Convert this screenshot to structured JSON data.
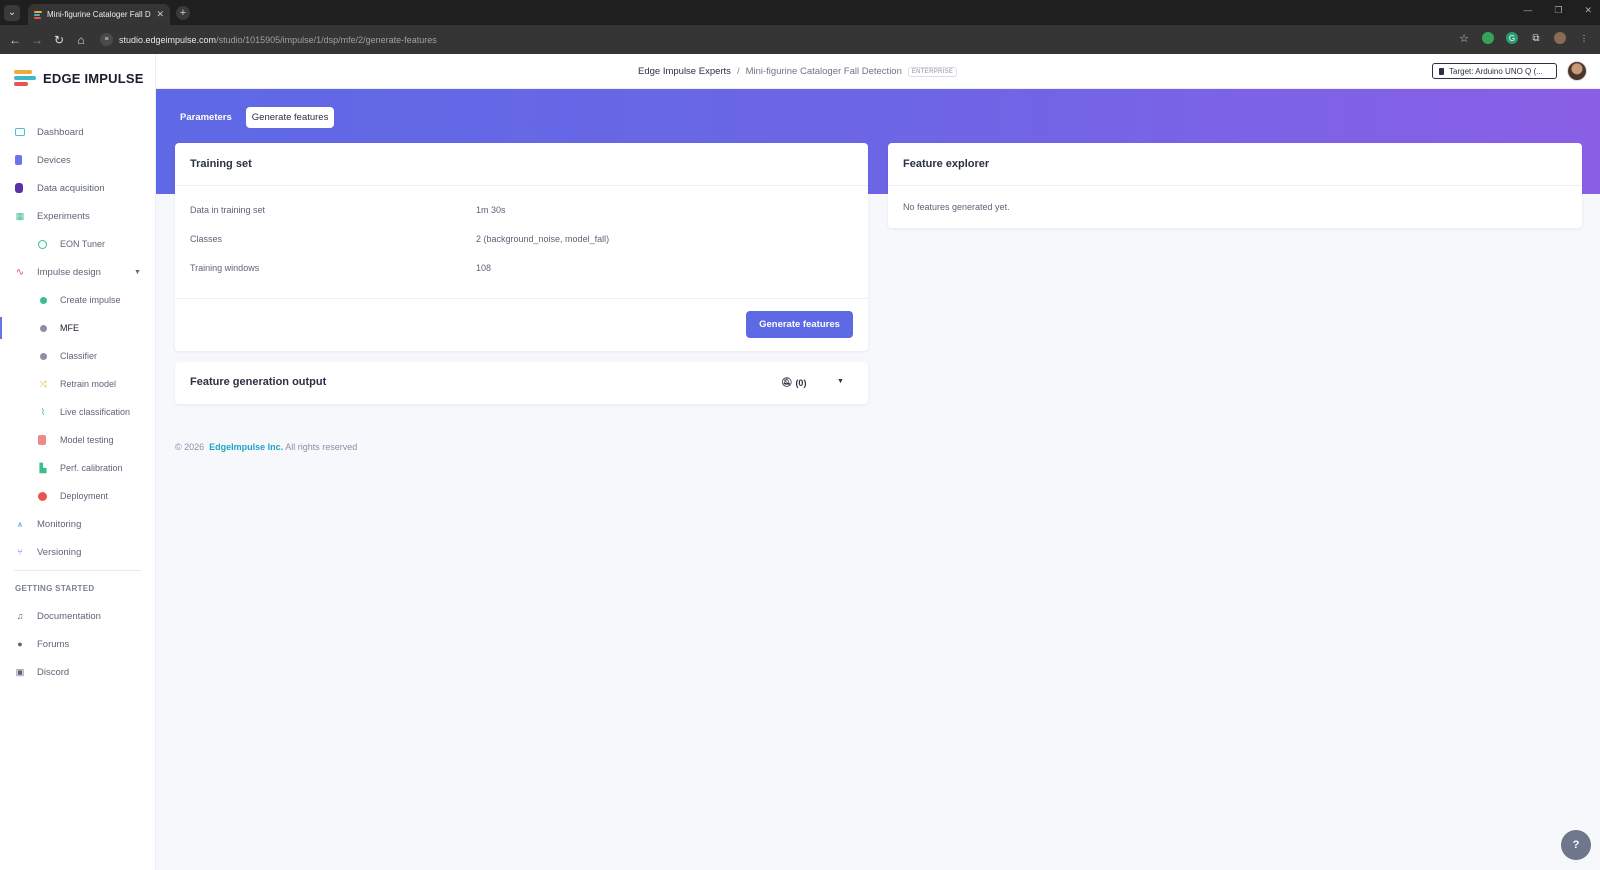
{
  "browser": {
    "tab_title": "Mini-figurine Cataloger Fall Det",
    "url_host": "studio.edgeimpulse.com",
    "url_path": "/studio/1015905/impulse/1/dsp/mfe/2/generate-features"
  },
  "brand": {
    "name": "EDGE IMPULSE"
  },
  "header": {
    "org": "Edge Impulse Experts",
    "separator": "/",
    "project": "Mini-figurine Cataloger Fall Detection",
    "plan_badge": "ENTERPRISE",
    "target_label": "Target: Arduino UNO Q (..."
  },
  "sidebar": {
    "items": [
      {
        "label": "Dashboard",
        "icon": "monitor-icon"
      },
      {
        "label": "Devices",
        "icon": "device-icon"
      },
      {
        "label": "Data acquisition",
        "icon": "database-icon"
      },
      {
        "label": "Experiments",
        "icon": "table-icon"
      },
      {
        "label": "EON Tuner",
        "icon": "tuner-icon"
      },
      {
        "label": "Impulse design",
        "icon": "pulse-icon"
      },
      {
        "label": "Create impulse",
        "icon": "dot-icon"
      },
      {
        "label": "MFE",
        "icon": "dot-icon"
      },
      {
        "label": "Classifier",
        "icon": "dot-icon"
      },
      {
        "label": "Retrain model",
        "icon": "shuffle-icon"
      },
      {
        "label": "Live classification",
        "icon": "live-icon"
      },
      {
        "label": "Model testing",
        "icon": "clipboard-icon"
      },
      {
        "label": "Perf. calibration",
        "icon": "bar-chart-icon"
      },
      {
        "label": "Deployment",
        "icon": "box-icon"
      },
      {
        "label": "Monitoring",
        "icon": "monitoring-icon"
      },
      {
        "label": "Versioning",
        "icon": "branch-icon"
      }
    ],
    "section_title": "GETTING STARTED",
    "getting_started": [
      {
        "label": "Documentation",
        "icon": "docs-icon"
      },
      {
        "label": "Forums",
        "icon": "forum-icon"
      },
      {
        "label": "Discord",
        "icon": "discord-icon"
      }
    ]
  },
  "tabs": {
    "parameters": "Parameters",
    "generate": "Generate features"
  },
  "training_set": {
    "title": "Training set",
    "rows": [
      {
        "label": "Data in training set",
        "value": "1m 30s"
      },
      {
        "label": "Classes",
        "value": "2 (background_noise, model_fall)"
      },
      {
        "label": "Training windows",
        "value": "108"
      }
    ],
    "button": "Generate features"
  },
  "feature_output": {
    "title": "Feature generation output",
    "count": "(0)"
  },
  "feature_explorer": {
    "title": "Feature explorer",
    "empty_text": "No features generated yet."
  },
  "footer": {
    "copyright": "© 2026",
    "company": "EdgeImpulse Inc.",
    "rights": "All rights reserved"
  },
  "colors": {
    "accent": "#5d6ae3",
    "banner_start": "#5f69e5",
    "banner_end": "#8a5fe6",
    "link": "#1ea5c4"
  }
}
